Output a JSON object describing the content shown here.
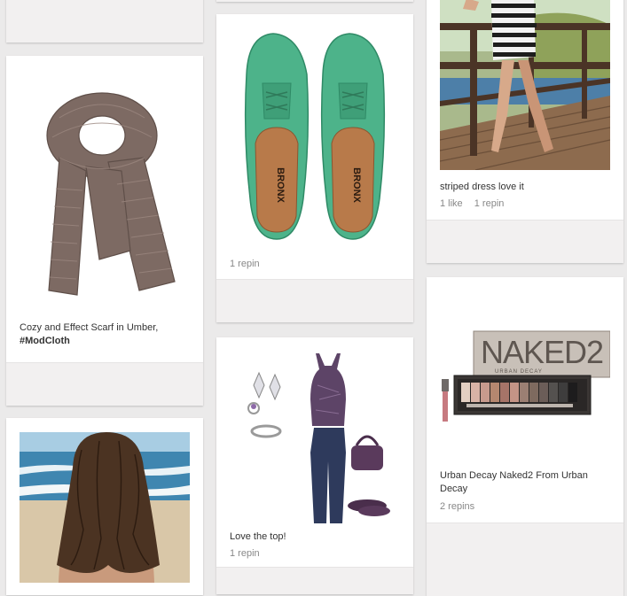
{
  "pins": [
    {
      "id": "scarf",
      "description": "Cozy and Effect Scarf in Umber,",
      "hashtag": "#ModCloth"
    },
    {
      "id": "shoes",
      "shoe_brand": "BRONX",
      "repins": "1 repin"
    },
    {
      "id": "dress",
      "description": "striped dress love it",
      "likes": "1 like",
      "repins": "1 repin"
    },
    {
      "id": "outfit",
      "description": "Love the top!",
      "repins": "1 repin"
    },
    {
      "id": "palette",
      "brand_big": "NAKED2",
      "brand_small": "URBAN DECAY",
      "description": "Urban Decay Naked2 From Urban Decay",
      "repins": "2 repins"
    },
    {
      "id": "hair"
    }
  ],
  "colors": {
    "page_bg": "#ebeaea",
    "card_bg": "#ffffff",
    "footer_bg": "#f2f0f0",
    "meta_text": "#888888"
  }
}
